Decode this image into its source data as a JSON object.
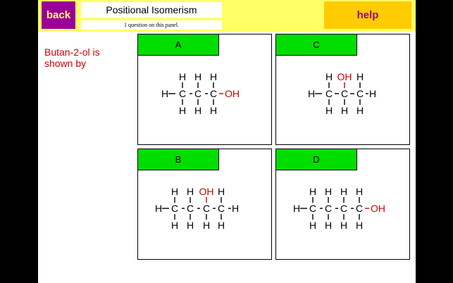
{
  "header": {
    "back_label": "back",
    "title": "Positional Isomerism",
    "note": "1 question on this panel.",
    "help_label": "help"
  },
  "question": "Butan-2-ol is shown by",
  "options": [
    {
      "label": "A",
      "molecule": "propan-1-ol"
    },
    {
      "label": "C",
      "molecule": "propan-2-ol"
    },
    {
      "label": "B",
      "molecule": "butan-2-ol"
    },
    {
      "label": "D",
      "molecule": "butan-1-ol"
    }
  ],
  "atoms": {
    "carbon": "C",
    "hydrogen": "H",
    "hydroxyl": "OH"
  },
  "colors": {
    "topbar": "#ffff66",
    "back": "#990099",
    "help": "#ffcc00",
    "label_bg": "#00dd00",
    "accent_red": "#cc0000"
  }
}
